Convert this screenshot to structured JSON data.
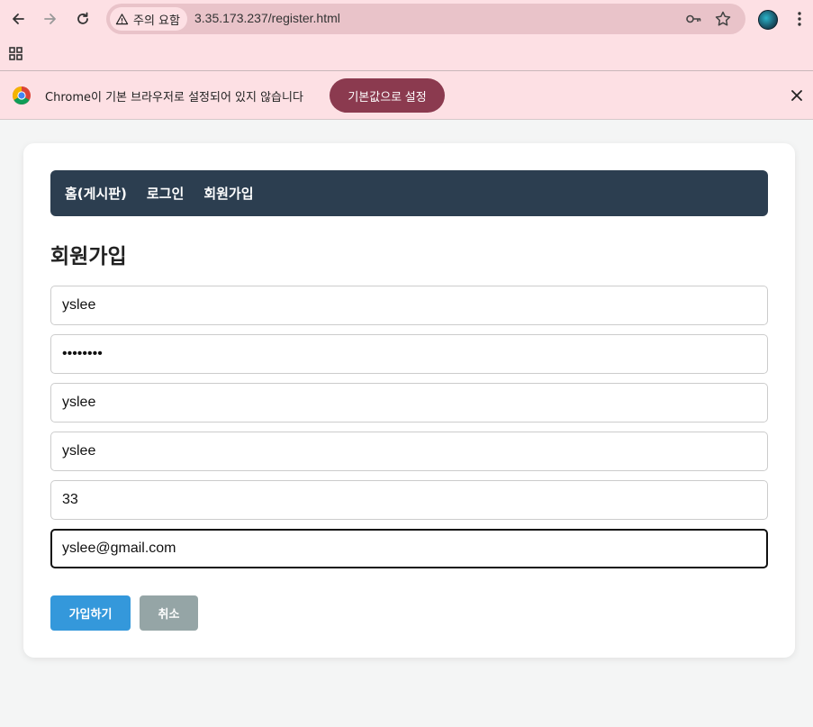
{
  "browser": {
    "security_label": "주의 요함",
    "url": "3.35.173.237/register.html",
    "infobar_message": "Chrome이 기본 브라우저로 설정되어 있지 않습니다",
    "infobar_button": "기본값으로 설정",
    "icons": [
      "back-arrow-icon",
      "forward-arrow-icon",
      "reload-icon",
      "warning-icon",
      "key-icon",
      "star-icon",
      "profile-avatar",
      "kebab-menu-icon",
      "apps-grid-icon",
      "chrome-logo-icon",
      "close-icon"
    ]
  },
  "site_nav": {
    "items": [
      {
        "label": "홈(게시판)"
      },
      {
        "label": "로그인"
      },
      {
        "label": "회원가입"
      }
    ]
  },
  "page": {
    "title": "회원가입"
  },
  "form": {
    "fields": [
      {
        "value": "yslee",
        "type": "text"
      },
      {
        "value": "••••••••",
        "type": "password"
      },
      {
        "value": "yslee",
        "type": "text"
      },
      {
        "value": "yslee",
        "type": "text"
      },
      {
        "value": "33",
        "type": "text"
      },
      {
        "value": "yslee@gmail.com",
        "type": "email"
      }
    ],
    "submit_label": "가입하기",
    "cancel_label": "취소"
  },
  "colors": {
    "nav_bg": "#2c3e50",
    "submit_bg": "#3498db",
    "cancel_bg": "#95a5a6",
    "infobar_button_bg": "#8b3a4f",
    "chrome_bg": "#fde0e4"
  }
}
